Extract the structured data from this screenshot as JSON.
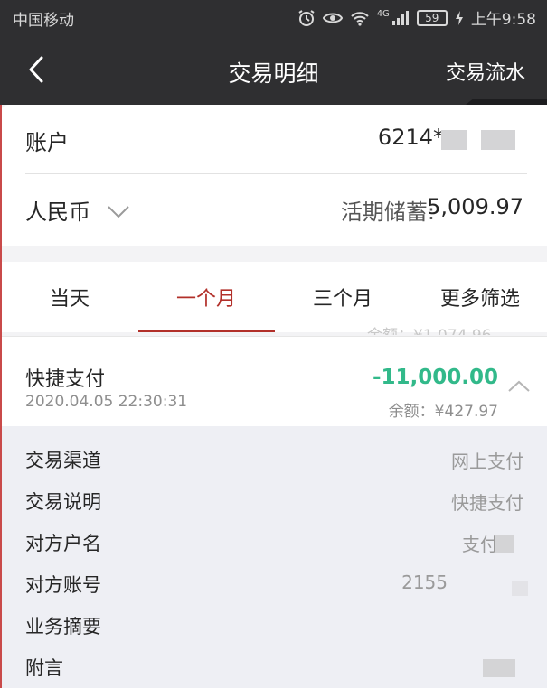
{
  "status_bar": {
    "carrier": "中国移动",
    "network": "4G",
    "battery": "59",
    "time": "上午9:58",
    "icons": [
      "alarm-icon",
      "eye-icon",
      "wifi-icon",
      "signal-icon",
      "battery-icon",
      "charging-icon"
    ]
  },
  "nav": {
    "back_icon": "chevron-left-icon",
    "title": "交易明细",
    "right_action": "交易流水"
  },
  "account": {
    "label": "账户",
    "number_visible": "6214*",
    "currency": "人民币",
    "balance_label": "活期储蓄:",
    "balance_value": "5,009.97"
  },
  "tabs": [
    {
      "label": "当天",
      "active": false
    },
    {
      "label": "一个月",
      "active": true
    },
    {
      "label": "三个月",
      "active": false
    },
    {
      "label": "更多筛选",
      "active": false
    }
  ],
  "partial_row": {
    "text": "余额：¥1,074.96"
  },
  "transaction": {
    "name": "快捷支付",
    "datetime": "2020.04.05 22:30:31",
    "amount": "-11,000.00",
    "balance": "余额：¥427.97",
    "expanded": true
  },
  "details": [
    {
      "key": "交易渠道",
      "value": "网上支付"
    },
    {
      "key": "交易说明",
      "value": "快捷支付"
    },
    {
      "key": "对方户名",
      "value": "支付"
    },
    {
      "key": "对方账号",
      "value": "2155"
    },
    {
      "key": "业务摘要",
      "value": ""
    },
    {
      "key": "附言",
      "value": ""
    }
  ],
  "colors": {
    "header_bg": "#2f2f31",
    "accent_red": "#b2302a",
    "amount_green": "#32b98a"
  }
}
